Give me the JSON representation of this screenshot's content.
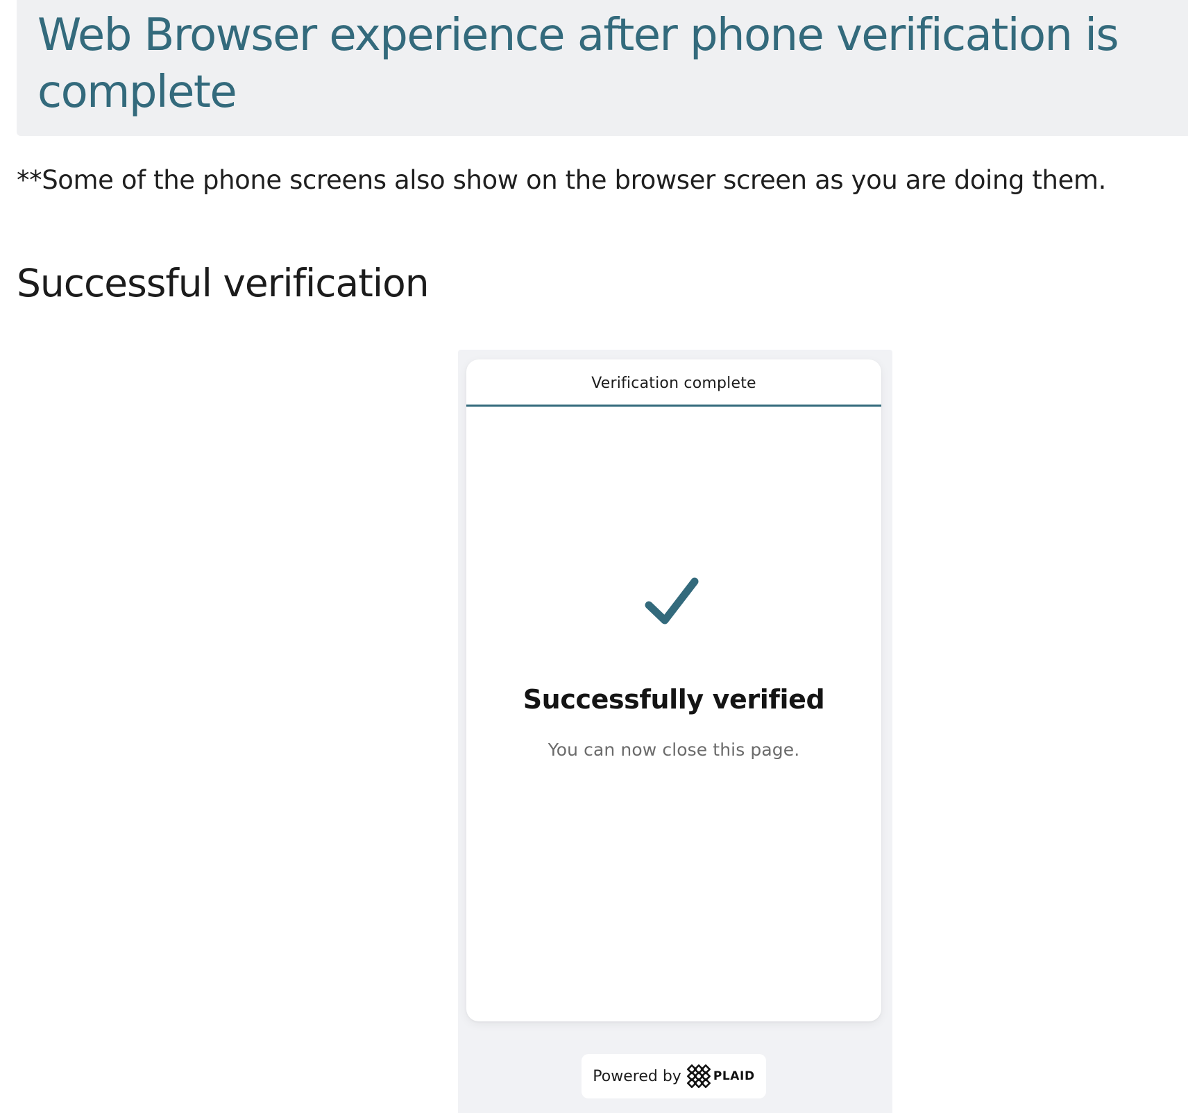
{
  "page": {
    "title": "Web Browser experience after phone verification is complete",
    "note": "**Some of the phone screens also show on the browser screen as you are doing them.",
    "section_heading": "Successful verification"
  },
  "screenshot": {
    "header_title": "Verification complete",
    "success_title": "Successfully verified",
    "success_subtitle": "You can now close this page.",
    "footer": {
      "powered_by": "Powered by",
      "brand": "PLAID"
    }
  },
  "colors": {
    "accent": "#336a7c",
    "banner_bg": "#eff0f2",
    "frame_bg": "#f1f2f5"
  },
  "icons": {
    "check": "checkmark-icon",
    "brand_mark": "plaid-logo-icon"
  }
}
